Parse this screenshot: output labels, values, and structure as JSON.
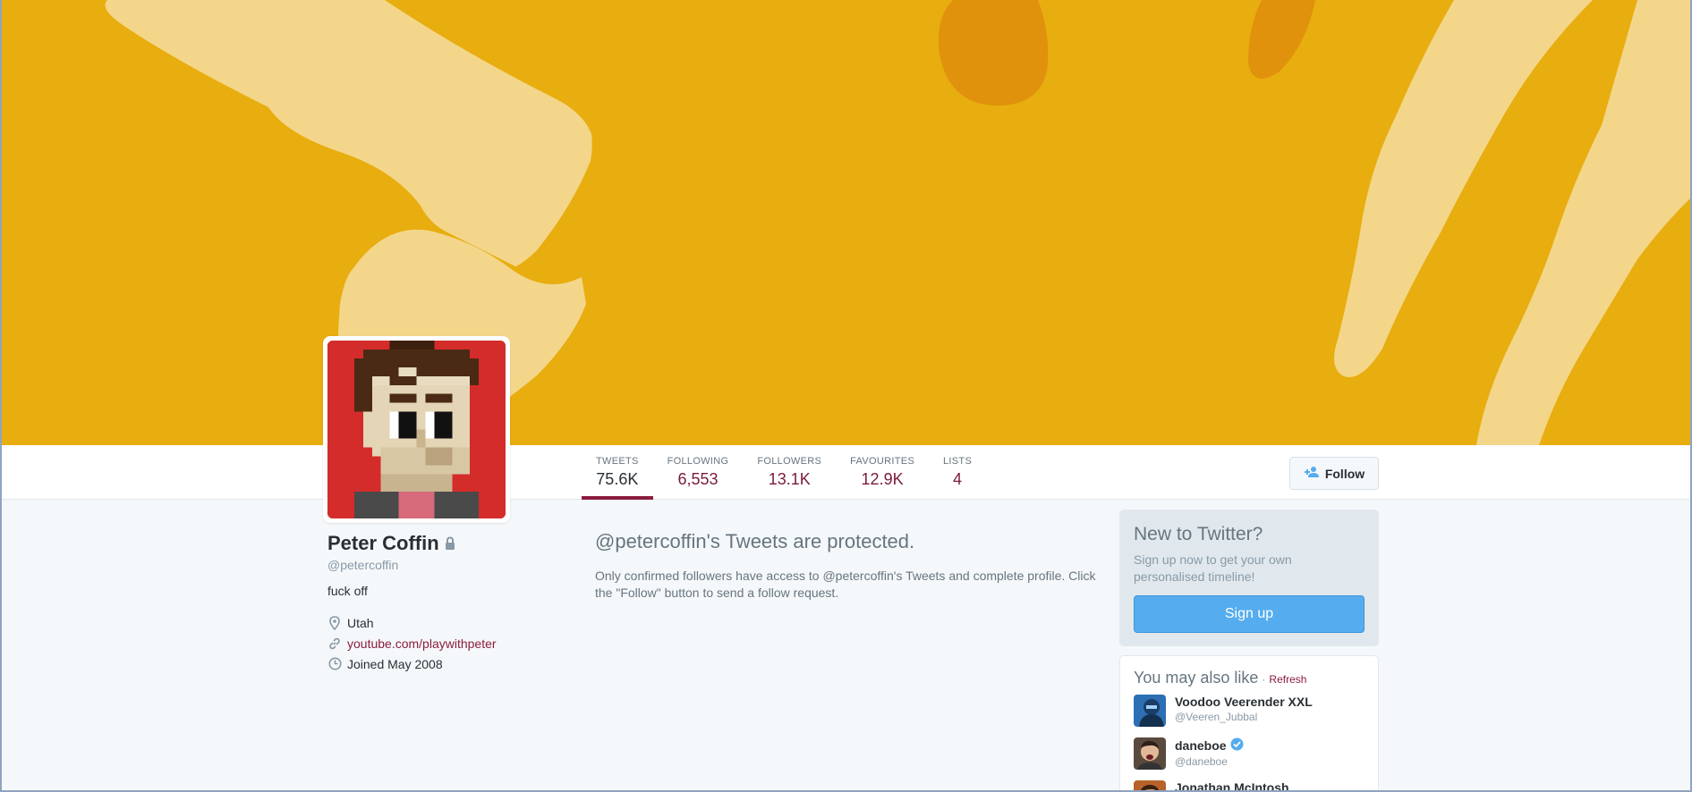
{
  "colors": {
    "banner": "#e8ad0e",
    "banner_shape_light": "#f3d68a",
    "banner_shape_dark": "#e0920c",
    "accent": "#8c1c3f",
    "signup_button": "#55acee"
  },
  "profile": {
    "name": "Peter Coffin",
    "handle": "@petercoffin",
    "bio": "fuck off",
    "location": "Utah",
    "website": "youtube.com/playwithpeter",
    "joined": "Joined May 2008",
    "lock_icon": "lock-icon"
  },
  "stats": [
    {
      "label": "TWEETS",
      "value": "75.6K"
    },
    {
      "label": "FOLLOWING",
      "value": "6,553"
    },
    {
      "label": "FOLLOWERS",
      "value": "13.1K"
    },
    {
      "label": "FAVOURITES",
      "value": "12.9K"
    },
    {
      "label": "LISTS",
      "value": "4"
    }
  ],
  "follow_button": {
    "label": "Follow",
    "icon": "add-user-icon"
  },
  "protected": {
    "title": "@petercoffin's Tweets are protected.",
    "message": "Only confirmed followers have access to @petercoffin's Tweets and complete profile. Click the \"Follow\" button to send a follow request."
  },
  "signup": {
    "title": "New to Twitter?",
    "text": "Sign up now to get your own personalised timeline!",
    "button": "Sign up"
  },
  "suggestions": {
    "title": "You may also like",
    "separator": "·",
    "refresh": "Refresh",
    "items": [
      {
        "name": "Voodoo Veerender XXL",
        "handle": "@Veeren_Jubbal",
        "verified": false
      },
      {
        "name": "daneboe",
        "handle": "@daneboe",
        "verified": true
      },
      {
        "name": "Jonathan McIntosh",
        "handle": "",
        "verified": false
      }
    ]
  }
}
